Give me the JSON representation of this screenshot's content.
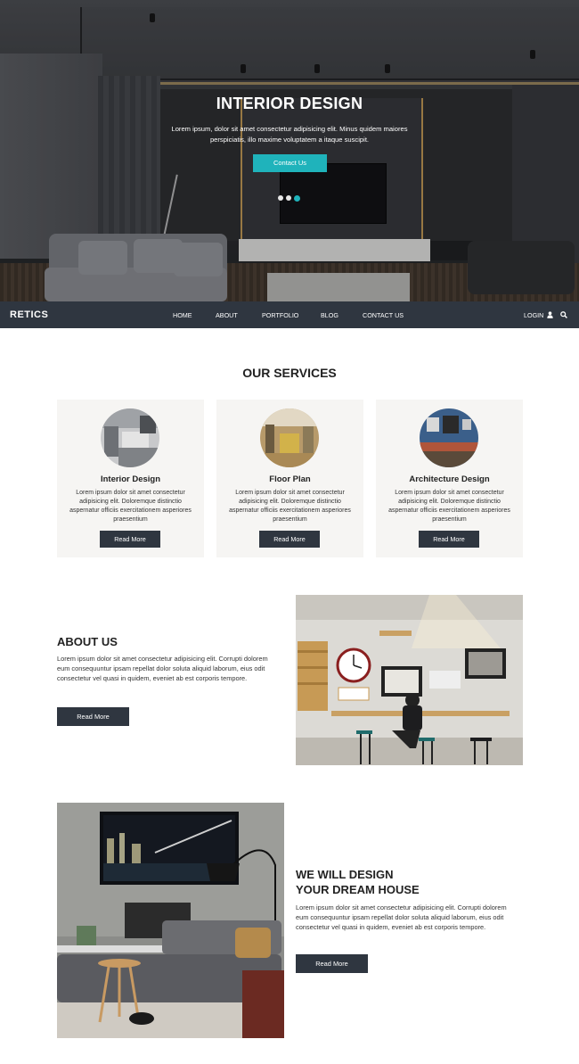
{
  "hero": {
    "title": "INTERIOR DESIGN",
    "text": "Lorem ipsum, dolor sit amet consectetur adipisicing elit. Minus quidem maiores perspiciatis, illo maxime voluptatem a itaque suscipit.",
    "button_label": "Contact Us",
    "slide_count": 3,
    "active_slide": 3,
    "accent_color": "#1fb3bb"
  },
  "nav": {
    "brand": "RETICS",
    "items": [
      {
        "label": "HOME"
      },
      {
        "label": "ABOUT"
      },
      {
        "label": "PORTFOLIO"
      },
      {
        "label": "BLOG"
      },
      {
        "label": "CONTACT US"
      }
    ],
    "login_label": "LOGIN",
    "icons": [
      "user-icon",
      "search-icon"
    ],
    "background_color": "#2f3640"
  },
  "services": {
    "title": "OUR SERVICES",
    "cards": [
      {
        "title": "Interior Design",
        "text": "Lorem ipsum dolor sit amet consectetur adipisicing elit. Doloremque distinctio aspernatur officiis exercitationem asperiores praesentium",
        "button_label": "Read More"
      },
      {
        "title": "Floor Plan",
        "text": "Lorem ipsum dolor sit amet consectetur adipisicing elit. Doloremque distinctio aspernatur officiis exercitationem asperiores praesentium",
        "button_label": "Read More"
      },
      {
        "title": "Architecture Design",
        "text": "Lorem ipsum dolor sit amet consectetur adipisicing elit. Doloremque distinctio aspernatur officiis exercitationem asperiores praesentium",
        "button_label": "Read More"
      }
    ]
  },
  "about": {
    "title": "ABOUT US",
    "text": "Lorem ipsum dolor sit amet consectetur adipisicing elit. Corrupti dolorem eum consequuntur ipsam repellat dolor soluta aliquid laborum, eius odit consectetur vel quasi in quidem, eveniet ab est corporis tempore.",
    "button_label": "Read More"
  },
  "design": {
    "title_line1": "WE WILL DESIGN",
    "title_line2": "YOUR DREAM HOUSE",
    "text": "Lorem ipsum dolor sit amet consectetur adipisicing elit. Corrupti dolorem eum consequuntur ipsam repellat dolor soluta aliquid laborum, eius odit consectetur vel quasi in quidem, eveniet ab est corporis tempore.",
    "button_label": "Read More"
  }
}
